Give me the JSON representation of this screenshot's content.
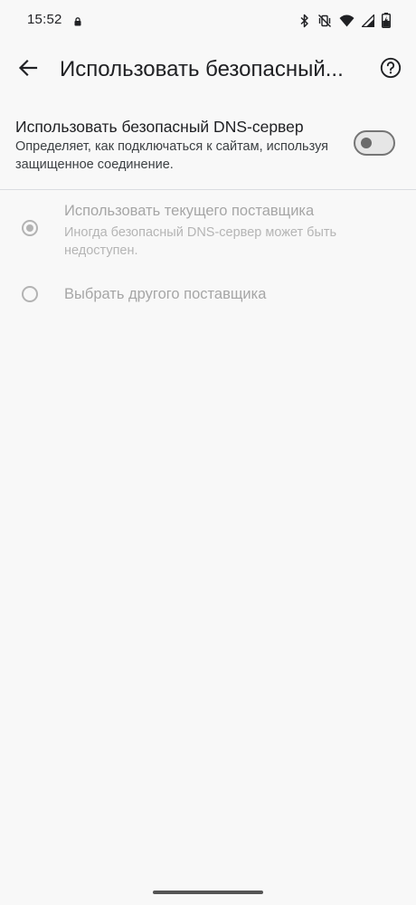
{
  "status_bar": {
    "time": "15:52",
    "icons": [
      "lock-icon",
      "bluetooth-icon",
      "vibrate-off-icon",
      "wifi-icon",
      "signal-icon",
      "battery-charging-icon"
    ]
  },
  "app_bar": {
    "title": "Использовать безопасный...",
    "back_icon": "arrow-back-icon",
    "help_icon": "help-icon"
  },
  "main_setting": {
    "title": "Использовать безопасный DNS-сервер",
    "description": "Определяет, как подключаться к сайтам, используя защищенное соединение.",
    "toggle_on": false
  },
  "options": [
    {
      "label": "Использовать текущего поставщика",
      "sublabel": "Иногда безопасный DNS-сервер может быть недоступен.",
      "selected": true,
      "enabled": false
    },
    {
      "label": "Выбрать другого поставщика",
      "selected": false,
      "enabled": false
    }
  ]
}
